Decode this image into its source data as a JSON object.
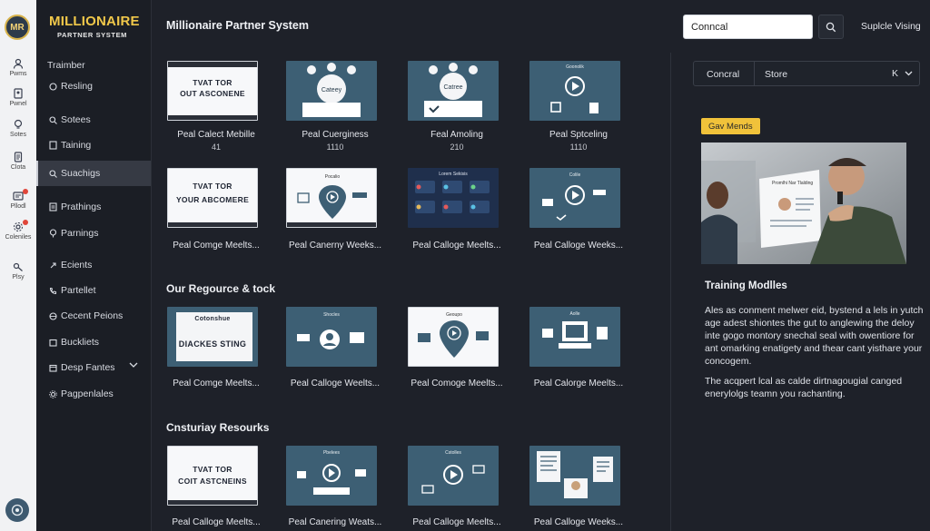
{
  "rail": {
    "logo": "MR",
    "items": [
      {
        "label": "Pwms",
        "icon": "user-icon"
      },
      {
        "label": "Pwnel",
        "icon": "person-icon"
      },
      {
        "label": "Sotes",
        "icon": "bulb-icon"
      },
      {
        "label": "Clota",
        "icon": "document-icon"
      },
      {
        "label": "Pllodl",
        "icon": "panel-icon"
      },
      {
        "label": "Coleniles",
        "icon": "settings-icon"
      },
      {
        "label": "Plsy",
        "icon": "key-icon"
      }
    ]
  },
  "sidebar": {
    "brand_title": "MILLIONAIRE",
    "brand_sub": "PARTNER SYSTEM",
    "items": [
      {
        "label": "Traimber"
      },
      {
        "label": "Resling"
      },
      {
        "label": "Sotees"
      },
      {
        "label": "Taining"
      },
      {
        "label": "Suachigs"
      },
      {
        "label": "Prathings"
      },
      {
        "label": "Parnings"
      },
      {
        "label": "Ecients"
      },
      {
        "label": "Partellet"
      },
      {
        "label": "Cecent Peions"
      },
      {
        "label": "Buckliets"
      },
      {
        "label": "Desp Fantes"
      },
      {
        "label": "Pagpenlales"
      }
    ]
  },
  "header": {
    "title": "Millionaire Partner System",
    "search_value": "Conncal",
    "link": "Suplcle Vising"
  },
  "main": {
    "sections": [
      {
        "title": ""
      },
      {
        "title": "Our Regource & tock"
      },
      {
        "title": "Cnsturiay Resourks"
      }
    ],
    "cards": [
      {
        "caption": "Peal Calect Mebille",
        "num": "41",
        "thumb_text": "TVAT TOR",
        "thumb_text2": "OUT ASCONENE"
      },
      {
        "caption": "Peal Cuerginess",
        "num": "1110",
        "thumb_text": "Cateey"
      },
      {
        "caption": "Feal Amoling",
        "num": "210",
        "thumb_text": "Catree"
      },
      {
        "caption": "Peal Sptceling",
        "num": "1110",
        "thumb_text": "Goonolik"
      },
      {
        "caption": "Peal Comge Meelts...",
        "thumb_text": "TVAT TOR",
        "thumb_text2": "YOUR ABCOMERE"
      },
      {
        "caption": "Peal Canerny Weeks...",
        "thumb_text": "Pocalio"
      },
      {
        "caption": "Peal Calloge Meelts...",
        "thumb_text": "Lorem Sekisis"
      },
      {
        "caption": "Peal Calloge Weeks...",
        "thumb_text": "Colile"
      },
      {
        "caption": "Peal Comge Meelts...",
        "thumb_text": "Cotonshue",
        "thumb_text2": "DIACKES STING"
      },
      {
        "caption": "Peal Calloge Weelts...",
        "thumb_text": "Shocles"
      },
      {
        "caption": "Peal Comoge Meelts...",
        "thumb_text": "Geoupo"
      },
      {
        "caption": "Peal Calorge Meelts...",
        "thumb_text": "Aolle"
      },
      {
        "caption": "Peal Calloge Meelts...",
        "thumb_text": "TVAT TOR",
        "thumb_text2": "COIT ASTCNEINS"
      },
      {
        "caption": "Peal Canering Weats...",
        "thumb_text": "Pbelees"
      },
      {
        "caption": "Peal Calloge Meelts...",
        "thumb_text": "Cstolles"
      },
      {
        "caption": "Peal Calloge Weeks...",
        "thumb_text": ""
      }
    ]
  },
  "panel": {
    "filter": {
      "a": "Concral",
      "b": "Store",
      "c": "K"
    },
    "badge": "Gav Mends",
    "hero_card_title": "Promlhi Nar Tlalding",
    "heading": "Training Modlles",
    "para1": "Ales as conment melwer eid, bystend a lels in yutch age adest shiontes the gut to anglewing the deloy inte gogo montory snechal seal with owentiore for ant omarking enatigety and thear cant yisthare your concogem.",
    "para2": "The acqpert lcal as calde dirtnagougial canged enerylolgs teamn you rachanting."
  },
  "colors": {
    "accent": "#f1c23a",
    "thumb_teal": "#3d5f74",
    "background": "#1e2129"
  }
}
